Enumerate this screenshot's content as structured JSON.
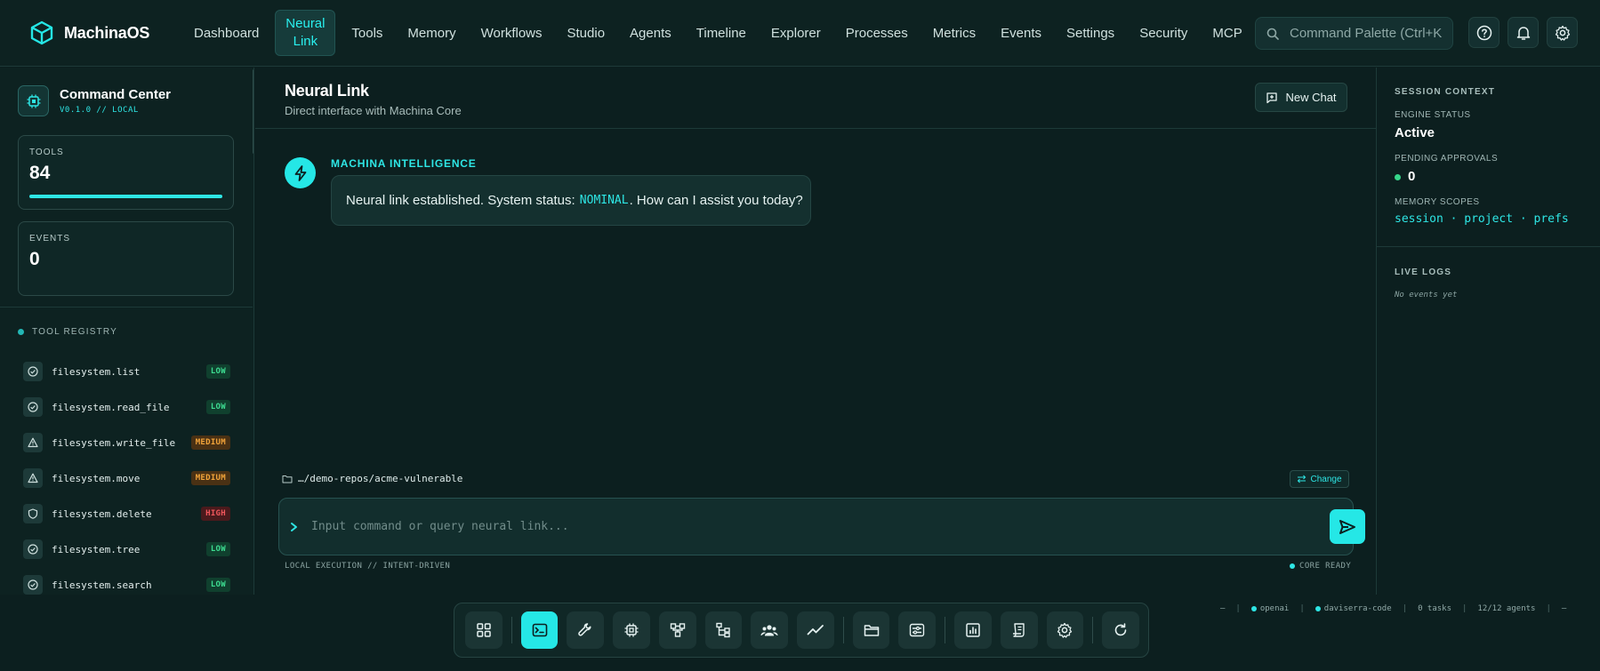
{
  "brand": {
    "name": "MachinaOS",
    "logo_icon": "cube-icon"
  },
  "nav": {
    "items": [
      {
        "label": "Dashboard",
        "active": false
      },
      {
        "label": "Neural Link",
        "active": true
      },
      {
        "label": "Tools",
        "active": false
      },
      {
        "label": "Memory",
        "active": false
      },
      {
        "label": "Workflows",
        "active": false
      },
      {
        "label": "Studio",
        "active": false
      },
      {
        "label": "Agents",
        "active": false
      },
      {
        "label": "Timeline",
        "active": false
      },
      {
        "label": "Explorer",
        "active": false
      },
      {
        "label": "Processes",
        "active": false
      },
      {
        "label": "Metrics",
        "active": false
      },
      {
        "label": "Events",
        "active": false
      },
      {
        "label": "Settings",
        "active": false
      },
      {
        "label": "Security",
        "active": false
      },
      {
        "label": "MCP",
        "active": false
      }
    ]
  },
  "search": {
    "placeholder": "Command Palette (Ctrl+K"
  },
  "header_icons": [
    "help-icon",
    "bell-icon",
    "gear-icon"
  ],
  "sidebar": {
    "title": "Command Center",
    "version": "V0.1.0 // LOCAL",
    "tools_card": {
      "label": "TOOLS",
      "value": "84",
      "progress": 1.0
    },
    "events_card": {
      "label": "EVENTS",
      "value": "0"
    },
    "registry_title": "TOOL REGISTRY",
    "tools": [
      {
        "name": "filesystem.list",
        "risk": "LOW",
        "level": "low",
        "icon": "check-circle-icon"
      },
      {
        "name": "filesystem.read_file",
        "risk": "LOW",
        "level": "low",
        "icon": "check-circle-icon"
      },
      {
        "name": "filesystem.write_file",
        "risk": "MEDIUM",
        "level": "medium",
        "icon": "warning-icon"
      },
      {
        "name": "filesystem.move",
        "risk": "MEDIUM",
        "level": "medium",
        "icon": "warning-icon"
      },
      {
        "name": "filesystem.delete",
        "risk": "HIGH",
        "level": "high",
        "icon": "shield-icon"
      },
      {
        "name": "filesystem.tree",
        "risk": "LOW",
        "level": "low",
        "icon": "check-circle-icon"
      },
      {
        "name": "filesystem.search",
        "risk": "LOW",
        "level": "low",
        "icon": "check-circle-icon"
      }
    ]
  },
  "main": {
    "title": "Neural Link",
    "subtitle": "Direct interface with Machina Core",
    "new_chat_label": "New Chat",
    "message": {
      "sender": "MACHINA INTELLIGENCE",
      "text_before": "Neural link established. System status: ",
      "keyword": "NOMINAL",
      "text_after": ". How can I assist you today?"
    },
    "workspace_path": "…/demo-repos/acme-vulnerable",
    "change_label": "Change",
    "input_placeholder": "Input command or query neural link...",
    "footer_left": "LOCAL EXECUTION // INTENT-DRIVEN",
    "footer_right": "CORE READY"
  },
  "session": {
    "title": "SESSION CONTEXT",
    "engine_label": "ENGINE STATUS",
    "engine_value": "Active",
    "approvals_label": "PENDING APPROVALS",
    "approvals_value": "0",
    "scopes_label": "MEMORY SCOPES",
    "scopes_value": "session · project · prefs",
    "logs_title": "LIVE LOGS",
    "logs_empty": "No events yet"
  },
  "status_strip": {
    "dash_left": "—",
    "provider": "openai",
    "user": "daviserra-code",
    "tasks": "0 tasks",
    "agents": "12/12 agents",
    "dash_right": "—"
  },
  "dock": {
    "items": [
      "grid-icon",
      "terminal-icon",
      "wrench-icon",
      "chip-icon",
      "workflow-icon",
      "tree-icon",
      "team-icon",
      "trend-icon",
      "folder-icon",
      "sliders-icon",
      "report-icon",
      "scroll-icon",
      "gear-icon",
      "refresh-icon"
    ],
    "active": "terminal-icon"
  },
  "colors": {
    "accent": "#25e7e6",
    "background": "#0c1f1f",
    "low": "#3ddc91",
    "medium": "#f2a43a",
    "high": "#f0575c"
  }
}
